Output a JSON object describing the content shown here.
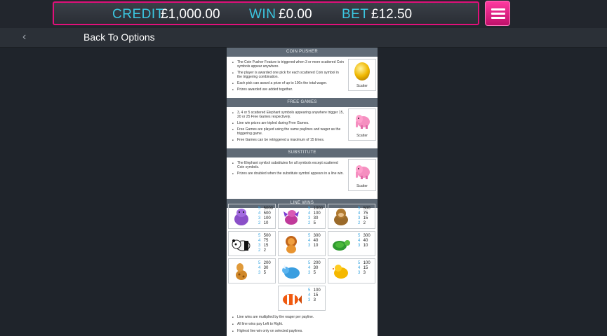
{
  "meter": {
    "credit_label": "CREDIT",
    "credit_value": "£1,000.00",
    "win_label": "WIN",
    "win_value": "£0.00",
    "bet_label": "BET",
    "bet_value": "£12.50"
  },
  "nav": {
    "back_arrow": "‹",
    "back_label": "Back To Options"
  },
  "coin_pusher": {
    "title": "COIN PUSHER",
    "bullets": [
      "The Coin Pusher Feature is triggered when 3 or more scattered Coin symbols appear anywhere.",
      "The player is awarded one pick for each scattered Coin symbol in the triggering combination.",
      "Each pick can award a prize of up to 100x the total wager.",
      "Prizes awarded are added together."
    ],
    "scatter_label": "Scatter"
  },
  "free_games": {
    "title": "FREE GAMES",
    "bullets": [
      "3, 4 or 5 scattered Elephant symbols appearing anywhere trigger 15, 20 or 25 Free Games respectively.",
      "Line win prizes are tripled during Free Games.",
      "Free Games are played using the same paylines and wager as the triggering game.",
      "Free Games can be retriggered a maximum of 15 times."
    ],
    "scatter_label": "Scatter"
  },
  "substitute": {
    "title": "SUBSTITUTE",
    "bullets": [
      "The Elephant symbol substitutes for all symbols except scattered Coin symbols.",
      "Prizes are doubled when the substitute symbol appears in a line win."
    ],
    "scatter_label": "Scatter"
  },
  "line_wins": {
    "title": "LINE WINS",
    "symbols": [
      {
        "name": "hippo-icon",
        "pays": [
          [
            "5",
            "5000"
          ],
          [
            "4",
            "500"
          ],
          [
            "3",
            "100"
          ],
          [
            "2",
            "10"
          ]
        ]
      },
      {
        "name": "dragon-icon",
        "pays": [
          [
            "5",
            "1000"
          ],
          [
            "4",
            "100"
          ],
          [
            "3",
            "30"
          ],
          [
            "2",
            "5"
          ]
        ]
      },
      {
        "name": "monkey-icon",
        "pays": [
          [
            "5",
            "500"
          ],
          [
            "4",
            "75"
          ],
          [
            "3",
            "15"
          ],
          [
            "2",
            "2"
          ]
        ]
      },
      {
        "name": "panda-icon",
        "pays": [
          [
            "5",
            "500"
          ],
          [
            "4",
            "75"
          ],
          [
            "3",
            "15"
          ],
          [
            "2",
            "2"
          ]
        ]
      },
      {
        "name": "lion-icon",
        "pays": [
          [
            "5",
            "300"
          ],
          [
            "4",
            "40"
          ],
          [
            "3",
            "10"
          ]
        ]
      },
      {
        "name": "turtle-icon",
        "pays": [
          [
            "5",
            "300"
          ],
          [
            "4",
            "40"
          ],
          [
            "3",
            "10"
          ]
        ]
      },
      {
        "name": "giraffe-icon",
        "pays": [
          [
            "5",
            "200"
          ],
          [
            "4",
            "30"
          ],
          [
            "3",
            "5"
          ]
        ]
      },
      {
        "name": "rhino-icon",
        "pays": [
          [
            "5",
            "200"
          ],
          [
            "4",
            "30"
          ],
          [
            "3",
            "5"
          ]
        ]
      },
      {
        "name": "chick-icon",
        "pays": [
          [
            "5",
            "100"
          ],
          [
            "4",
            "15"
          ],
          [
            "3",
            "3"
          ]
        ]
      },
      {
        "name": "clownfish-icon",
        "pays": [
          [
            "5",
            "100"
          ],
          [
            "4",
            "15"
          ],
          [
            "3",
            "3"
          ]
        ]
      }
    ],
    "footer": [
      "Line wins are multiplied by the wager per payline.",
      "All line wins pay Left to Right.",
      "Highest line win only on selected paylines."
    ]
  }
}
